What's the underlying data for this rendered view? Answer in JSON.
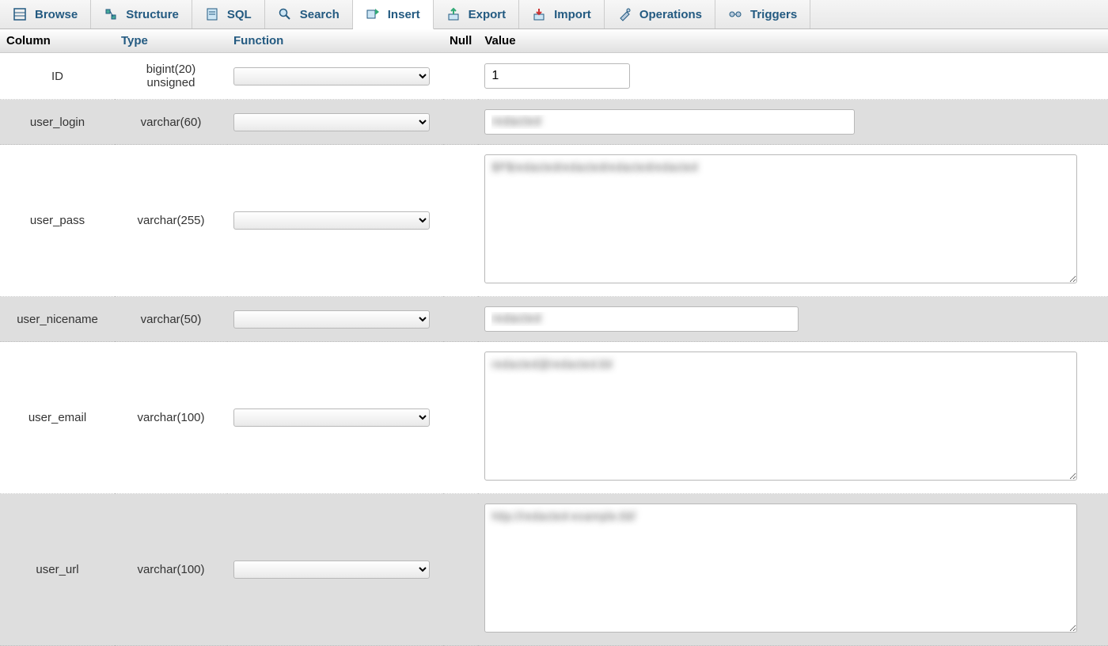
{
  "tabs": [
    {
      "label": "Browse"
    },
    {
      "label": "Structure"
    },
    {
      "label": "SQL"
    },
    {
      "label": "Search"
    },
    {
      "label": "Insert",
      "active": true
    },
    {
      "label": "Export"
    },
    {
      "label": "Import"
    },
    {
      "label": "Operations"
    },
    {
      "label": "Triggers"
    }
  ],
  "headers": {
    "column": "Column",
    "type": "Type",
    "function": "Function",
    "null": "Null",
    "value": "Value"
  },
  "rows": [
    {
      "column": "ID",
      "type": "bigint(20) unsigned",
      "kind": "input",
      "value": "1",
      "width_class": "w-id",
      "blurred": false
    },
    {
      "column": "user_login",
      "type": "varchar(60)",
      "kind": "input",
      "value": "redacted",
      "width_class": "w-login",
      "blurred": true
    },
    {
      "column": "user_pass",
      "type": "varchar(255)",
      "kind": "textarea",
      "value": "$P$redactedredactedredactedredacted",
      "width_class": "w-big",
      "blurred": true
    },
    {
      "column": "user_nicename",
      "type": "varchar(50)",
      "kind": "input",
      "value": "redacted",
      "width_class": "w-nice",
      "blurred": true
    },
    {
      "column": "user_email",
      "type": "varchar(100)",
      "kind": "textarea",
      "value": "redacted@redacted.tld",
      "width_class": "w-big",
      "blurred": true
    },
    {
      "column": "user_url",
      "type": "varchar(100)",
      "kind": "textarea",
      "value": "http://redacted-example.tld/",
      "width_class": "w-big",
      "blurred": true
    }
  ]
}
